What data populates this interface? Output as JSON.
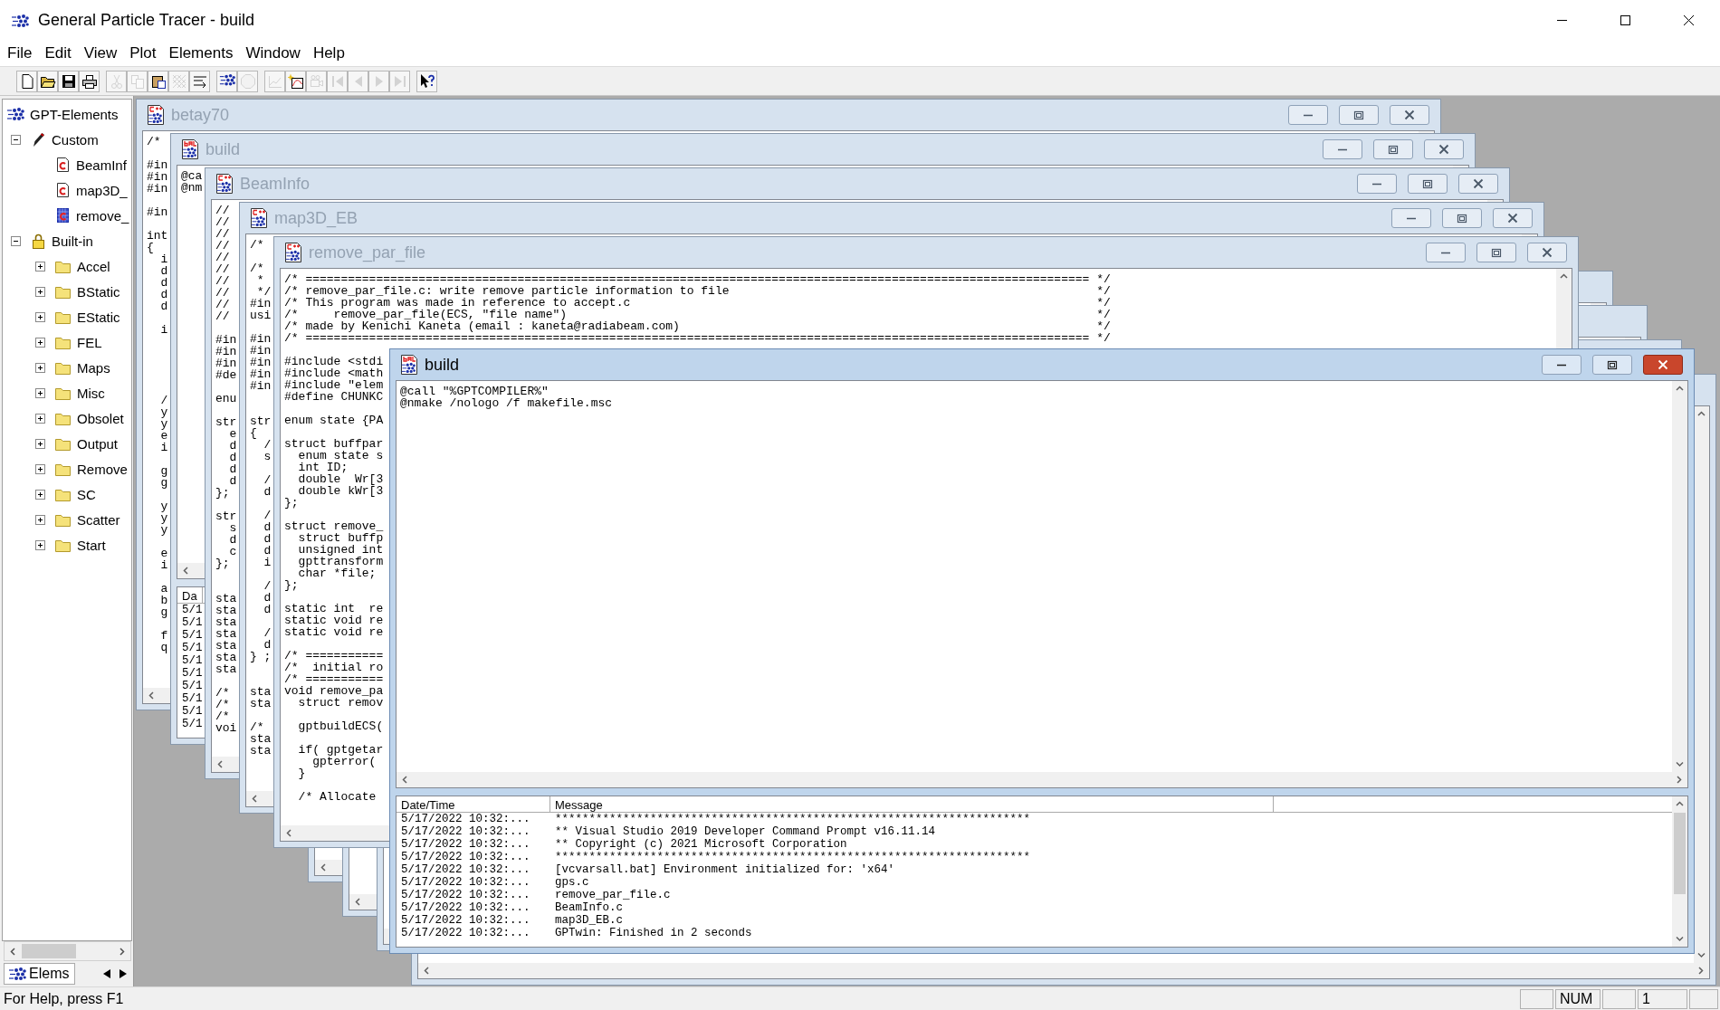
{
  "app": {
    "title": "General Particle Tracer - build"
  },
  "menu": [
    "File",
    "Edit",
    "View",
    "Plot",
    "Elements",
    "Window",
    "Help"
  ],
  "toolbar": {
    "groups": [
      {
        "buttons": [
          {
            "kind": "new",
            "disabled": false
          },
          {
            "kind": "open",
            "disabled": false
          },
          {
            "kind": "save",
            "disabled": false
          },
          {
            "kind": "print",
            "disabled": false
          }
        ]
      },
      {
        "buttons": [
          {
            "kind": "cut",
            "disabled": true
          },
          {
            "kind": "copy",
            "disabled": true
          },
          {
            "kind": "paste",
            "disabled": false
          },
          {
            "kind": "hatch",
            "disabled": true
          },
          {
            "kind": "numbering",
            "disabled": false
          }
        ]
      },
      {
        "buttons": [
          {
            "kind": "particles",
            "disabled": false
          },
          {
            "kind": "stop",
            "disabled": true
          }
        ]
      },
      {
        "buttons": [
          {
            "kind": "gdf",
            "disabled": true
          },
          {
            "kind": "plot",
            "disabled": false
          },
          {
            "kind": "camera",
            "disabled": true
          },
          {
            "kind": "first",
            "disabled": true
          },
          {
            "kind": "prev",
            "disabled": true
          },
          {
            "kind": "next",
            "disabled": true
          },
          {
            "kind": "last",
            "disabled": true
          }
        ]
      },
      {
        "buttons": [
          {
            "kind": "help",
            "disabled": false
          }
        ]
      }
    ]
  },
  "tree": {
    "label": "GPT-Elements",
    "kind": "root",
    "children": [
      {
        "label": "Custom",
        "kind": "custom",
        "expanded": true,
        "children": [
          {
            "label": "BeamInf",
            "kind": "c-file"
          },
          {
            "label": "map3D_",
            "kind": "c-file"
          },
          {
            "label": "remove_",
            "kind": "c-file-checked"
          }
        ]
      },
      {
        "label": "Built-in",
        "kind": "builtin",
        "expanded": true,
        "children": [
          {
            "label": "Accel",
            "kind": "folder",
            "expanded": false
          },
          {
            "label": "BStatic",
            "kind": "folder",
            "expanded": false
          },
          {
            "label": "EStatic",
            "kind": "folder",
            "expanded": false
          },
          {
            "label": "FEL",
            "kind": "folder",
            "expanded": false
          },
          {
            "label": "Maps",
            "kind": "folder",
            "expanded": false
          },
          {
            "label": "Misc",
            "kind": "folder",
            "expanded": false
          },
          {
            "label": "Obsolet",
            "kind": "folder",
            "expanded": false
          },
          {
            "label": "Output",
            "kind": "folder",
            "expanded": false
          },
          {
            "label": "Remove",
            "kind": "folder",
            "expanded": false
          },
          {
            "label": "SC",
            "kind": "folder",
            "expanded": false
          },
          {
            "label": "Scatter",
            "kind": "folder",
            "expanded": false
          },
          {
            "label": "Start",
            "kind": "folder",
            "expanded": false
          }
        ]
      }
    ]
  },
  "panel_tabs": [
    {
      "label": "Elems",
      "selected": true
    }
  ],
  "windows": [
    {
      "title": "betay70",
      "kind": "source",
      "active": false,
      "code": "/*\n\n#in\n#in\n#in\n\n#in\n\nint\n{\n  i\n  d\n  d\n  d\n  d\n\n  i\n\n\n\n\n\n  /\n  y\n  y\n  e\n  i\n\n  g\n  g\n\n  y\n  y\n  y\n\n  e\n  i\n\n  a\n  b\n  g\n\n  f\n  q"
    },
    {
      "title": "build",
      "kind": "batch",
      "active": false,
      "code": "@ca\n@nm",
      "log": {
        "columns": [
          "Da"
        ],
        "rows": [
          [
            "5/1"
          ],
          [
            "5/1"
          ],
          [
            "5/1"
          ],
          [
            "5/1"
          ],
          [
            "5/1"
          ],
          [
            "5/1"
          ],
          [
            "5/1"
          ],
          [
            "5/1"
          ],
          [
            "5/1"
          ],
          [
            "5/1"
          ]
        ]
      }
    },
    {
      "title": "BeamInfo",
      "kind": "source",
      "active": false,
      "code": "//\n//\n//\n//\n//\n//\n//\n//\n//\n//\n\n#in\n#in\n#in\n#de\n\nenu\n\nstr\n  e\n  d\n  d\n  d\n  d\n};\n\nstr\n  s\n  d\n  c\n};\n\n\nsta\nsta\nsta\nsta\nsta\nsta\nsta\n\n/*\n/*\n/*\nvoi"
    },
    {
      "title": "map3D_EB",
      "kind": "source",
      "active": false,
      "code": "/*\n\n/*\n *\n */\n#in\nusi\n\n#in\n#in\n#in\n#in\n#in\n\n\nstr\n{\n  /\n  s\n\n  /\n  d\n\n  /\n  d\n  d\n  d\n  i\n\n  /\n  d\n  d\n\n  /\n  d\n} ;\n\n\nsta\nsta\n\n/*\nsta\nsta"
    },
    {
      "title": "remove_par_file",
      "kind": "source",
      "active": false,
      "code": "/* =============================================================================================================== */\n/* remove_par_file.c: write remove particle information to file                                                    */\n/* This program was made in reference to accept.c                                                                  */\n/*     remove_par_file(ECS, \"file name\")                                                                           */\n/* made by Kenichi Kaneta (email : kaneta@radiabeam.com)                                                           */\n/* =============================================================================================================== */\n\n#include <stdi\n#include <math\n#include \"elem\n#define CHUNKC\n\nenum state {PA\n\nstruct buffpar\n  enum state s\n  int ID;\n  double  Wr[3\n  double kWr[3\n};\n\nstruct remove_\n  struct buffp\n  unsigned int\n  gpttransform\n  char *file;\n};\n\nstatic int  re\nstatic void re\nstatic void re\n\n/* ===========\n/*  initial ro\n/* ===========\nvoid remove_pa\n  struct remov\n\n  gptbuildECS(\n\n  if( gptgetar\n    gpterror(\n  }\n\n  /* Allocate"
    },
    {
      "kind": "hidden"
    },
    {
      "kind": "hidden"
    },
    {
      "kind": "hidden"
    },
    {
      "kind": "hidden"
    },
    {
      "title": "build",
      "kind": "batch",
      "active": true,
      "code": "@call \"%GPTCOMPILER%\"\n@nmake /nologo /f makefile.msc",
      "log": {
        "columns": [
          "Date/Time",
          "Message"
        ],
        "rows": [
          [
            "5/17/2022 10:32:...",
            "**********************************************************************"
          ],
          [
            "5/17/2022 10:32:...",
            "** Visual Studio 2019 Developer Command Prompt v16.11.14"
          ],
          [
            "5/17/2022 10:32:...",
            "** Copyright (c) 2021 Microsoft Corporation"
          ],
          [
            "5/17/2022 10:32:...",
            "**********************************************************************"
          ],
          [
            "5/17/2022 10:32:...",
            "[vcvarsall.bat] Environment initialized for: 'x64'"
          ],
          [
            "5/17/2022 10:32:...",
            "gps.c"
          ],
          [
            "5/17/2022 10:32:...",
            "remove_par_file.c"
          ],
          [
            "5/17/2022 10:32:...",
            "BeamInfo.c"
          ],
          [
            "5/17/2022 10:32:...",
            "map3D_EB.c"
          ],
          [
            "5/17/2022 10:32:...",
            "GPTwin: Finished in 2 seconds"
          ]
        ]
      }
    }
  ],
  "status_bar": {
    "message": "For Help, press F1",
    "indicators": [
      {
        "label": "NUM"
      },
      {
        "label": "1"
      }
    ]
  }
}
